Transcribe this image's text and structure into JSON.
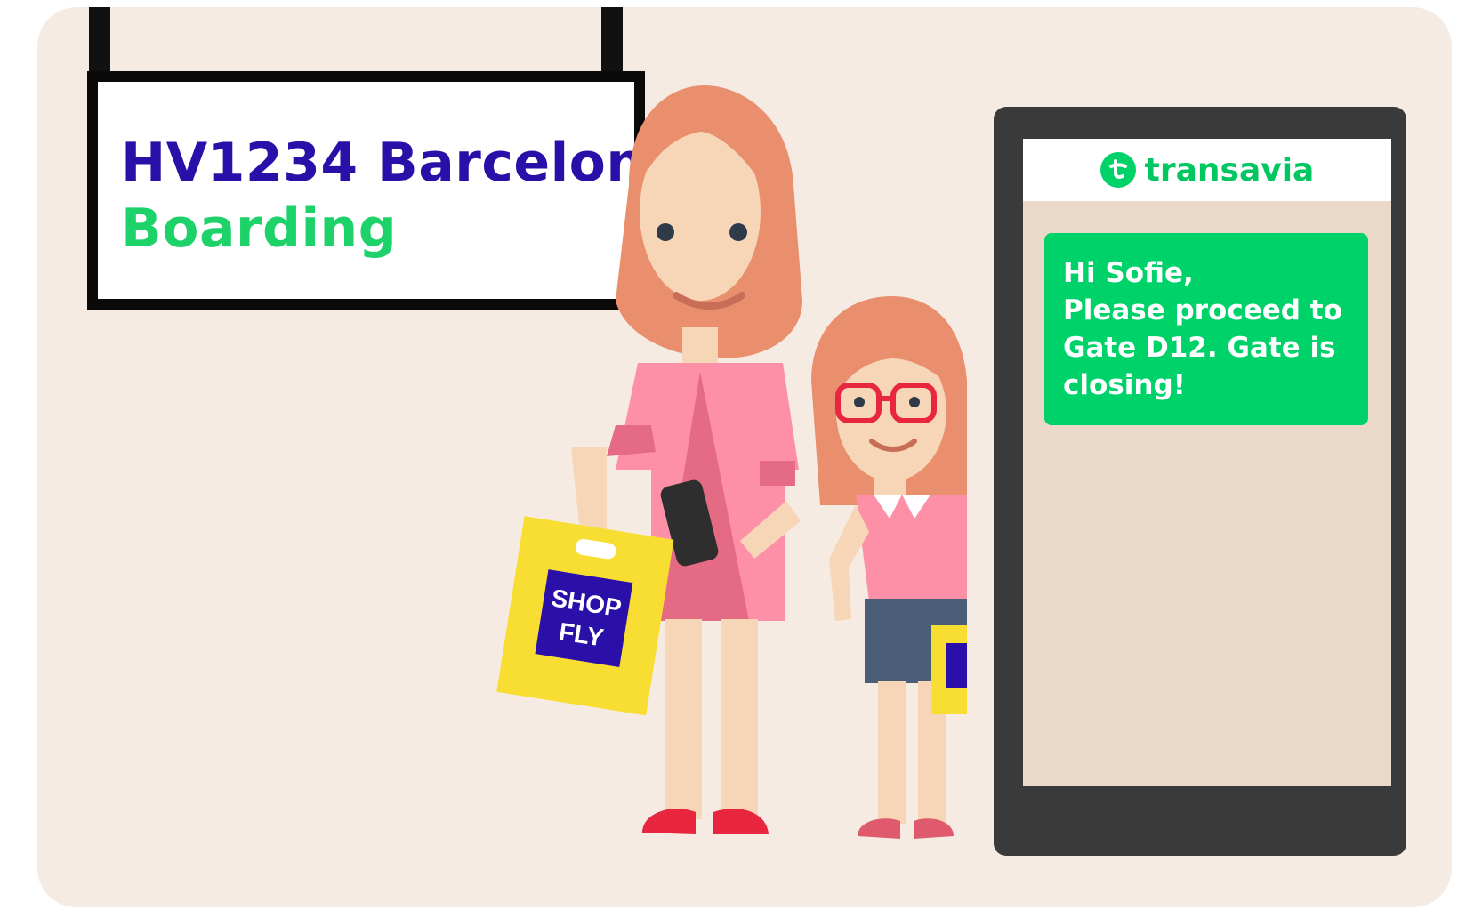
{
  "sign": {
    "flight": "HV1234 Barcelona",
    "status": "Boarding"
  },
  "bag": {
    "line1": "SHOP",
    "line2": "FLY"
  },
  "phone": {
    "brand": "transavia",
    "message": {
      "greeting": "Hi Sofie,",
      "line1": "Please proceed to",
      "line2": "Gate D12. Gate is",
      "line3": "closing!"
    }
  },
  "colors": {
    "background": "#f5ebe3",
    "sign_flight": "#2a0fa8",
    "brand_green": "#00d26a",
    "phone_frame": "#3a3a3a",
    "bag_yellow": "#f8de33"
  }
}
